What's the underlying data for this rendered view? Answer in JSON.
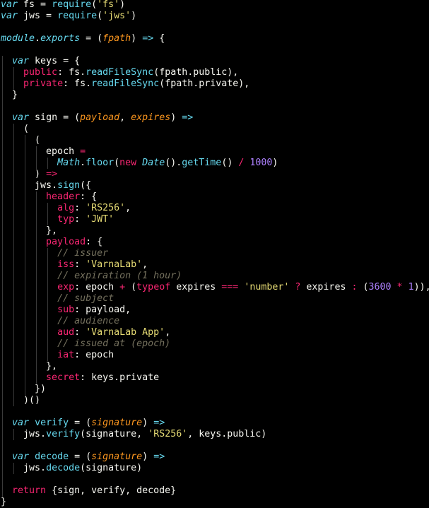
{
  "editor": {
    "theme": {
      "background": "#000000",
      "foreground": "#f8f8f2",
      "keyword": "#66d9ef",
      "property": "#f92672",
      "string": "#e6db74",
      "number": "#ae81ff",
      "parameter": "#fd971f",
      "comment": "#75715e"
    },
    "lines": [
      {
        "indent": 0,
        "tokens": [
          [
            "kw",
            "var"
          ],
          [
            "pl",
            " fs = "
          ],
          [
            "call",
            "require"
          ],
          [
            "pl",
            "("
          ],
          [
            "str",
            "'fs'"
          ],
          [
            "pl",
            ")"
          ]
        ]
      },
      {
        "indent": 0,
        "tokens": [
          [
            "kw",
            "var"
          ],
          [
            "pl",
            " jws = "
          ],
          [
            "call",
            "require"
          ],
          [
            "pl",
            "("
          ],
          [
            "str",
            "'jws'"
          ],
          [
            "pl",
            ")"
          ]
        ]
      },
      {
        "indent": 0,
        "tokens": []
      },
      {
        "indent": 0,
        "tokens": [
          [
            "it",
            "module"
          ],
          [
            "pl",
            "."
          ],
          [
            "it",
            "exports"
          ],
          [
            "pl",
            " = ("
          ],
          [
            "par",
            "fpath"
          ],
          [
            "pl",
            ") "
          ],
          [
            "call",
            "=>"
          ],
          [
            "pl",
            " {"
          ]
        ]
      },
      {
        "indent": 0,
        "tokens": []
      },
      {
        "indent": 2,
        "tokens": [
          [
            "kw",
            "var"
          ],
          [
            "pl",
            " keys = {"
          ]
        ]
      },
      {
        "indent": 4,
        "tokens": [
          [
            "key",
            "public"
          ],
          [
            "pl",
            ": fs."
          ],
          [
            "call",
            "readFileSync"
          ],
          [
            "pl",
            "(fpath.public),"
          ]
        ]
      },
      {
        "indent": 4,
        "tokens": [
          [
            "key",
            "private"
          ],
          [
            "pl",
            ": fs."
          ],
          [
            "call",
            "readFileSync"
          ],
          [
            "pl",
            "(fpath.private),"
          ]
        ]
      },
      {
        "indent": 2,
        "tokens": [
          [
            "pl",
            "}"
          ]
        ]
      },
      {
        "indent": 0,
        "tokens": []
      },
      {
        "indent": 2,
        "tokens": [
          [
            "kw",
            "var"
          ],
          [
            "pl",
            " sign = ("
          ],
          [
            "par",
            "payload"
          ],
          [
            "pl",
            ", "
          ],
          [
            "par",
            "expires"
          ],
          [
            "pl",
            ") "
          ],
          [
            "call",
            "=>"
          ]
        ]
      },
      {
        "indent": 4,
        "tokens": [
          [
            "pl",
            "("
          ]
        ]
      },
      {
        "indent": 6,
        "tokens": [
          [
            "pl",
            "("
          ]
        ]
      },
      {
        "indent": 8,
        "tokens": [
          [
            "pl",
            "epoch "
          ],
          [
            "op",
            "="
          ]
        ]
      },
      {
        "indent": 10,
        "tokens": [
          [
            "it",
            "Math"
          ],
          [
            "pl",
            "."
          ],
          [
            "call",
            "floor"
          ],
          [
            "pl",
            "("
          ],
          [
            "key",
            "new"
          ],
          [
            "pl",
            " "
          ],
          [
            "it",
            "Date"
          ],
          [
            "pl",
            "()."
          ],
          [
            "call",
            "getTime"
          ],
          [
            "pl",
            "() "
          ],
          [
            "op",
            "/"
          ],
          [
            "pl",
            " "
          ],
          [
            "num",
            "1000"
          ],
          [
            "pl",
            ")"
          ]
        ]
      },
      {
        "indent": 6,
        "tokens": [
          [
            "pl",
            ") "
          ],
          [
            "op",
            "=>"
          ]
        ]
      },
      {
        "indent": 6,
        "tokens": [
          [
            "pl",
            "jws."
          ],
          [
            "call",
            "sign"
          ],
          [
            "pl",
            "({"
          ]
        ]
      },
      {
        "indent": 8,
        "tokens": [
          [
            "key",
            "header"
          ],
          [
            "pl",
            ": {"
          ]
        ]
      },
      {
        "indent": 10,
        "tokens": [
          [
            "key",
            "alg"
          ],
          [
            "pl",
            ": "
          ],
          [
            "str",
            "'RS256'"
          ],
          [
            "pl",
            ","
          ]
        ]
      },
      {
        "indent": 10,
        "tokens": [
          [
            "key",
            "typ"
          ],
          [
            "pl",
            ": "
          ],
          [
            "str",
            "'JWT'"
          ]
        ]
      },
      {
        "indent": 8,
        "tokens": [
          [
            "pl",
            "},"
          ]
        ]
      },
      {
        "indent": 8,
        "tokens": [
          [
            "key",
            "payload"
          ],
          [
            "pl",
            ": {"
          ]
        ]
      },
      {
        "indent": 10,
        "tokens": [
          [
            "cm",
            "// issuer"
          ]
        ]
      },
      {
        "indent": 10,
        "tokens": [
          [
            "key",
            "iss"
          ],
          [
            "pl",
            ": "
          ],
          [
            "str",
            "'VarnaLab'"
          ],
          [
            "pl",
            ","
          ]
        ]
      },
      {
        "indent": 10,
        "tokens": [
          [
            "cm",
            "// expiration (1 hour)"
          ]
        ]
      },
      {
        "indent": 10,
        "tokens": [
          [
            "key",
            "exp"
          ],
          [
            "pl",
            ": epoch "
          ],
          [
            "op",
            "+"
          ],
          [
            "pl",
            " ("
          ],
          [
            "key",
            "typeof"
          ],
          [
            "pl",
            " expires "
          ],
          [
            "op",
            "==="
          ],
          [
            "pl",
            " "
          ],
          [
            "str",
            "'number'"
          ],
          [
            "pl",
            " "
          ],
          [
            "op",
            "?"
          ],
          [
            "pl",
            " expires "
          ],
          [
            "op",
            ":"
          ],
          [
            "pl",
            " ("
          ],
          [
            "num",
            "3600"
          ],
          [
            "pl",
            " "
          ],
          [
            "op",
            "*"
          ],
          [
            "pl",
            " "
          ],
          [
            "num",
            "1"
          ],
          [
            "pl",
            ")),"
          ]
        ]
      },
      {
        "indent": 10,
        "tokens": [
          [
            "cm",
            "// subject"
          ]
        ]
      },
      {
        "indent": 10,
        "tokens": [
          [
            "key",
            "sub"
          ],
          [
            "pl",
            ": payload,"
          ]
        ]
      },
      {
        "indent": 10,
        "tokens": [
          [
            "cm",
            "// audience"
          ]
        ]
      },
      {
        "indent": 10,
        "tokens": [
          [
            "key",
            "aud"
          ],
          [
            "pl",
            ": "
          ],
          [
            "str",
            "'VarnaLab App'"
          ],
          [
            "pl",
            ","
          ]
        ]
      },
      {
        "indent": 10,
        "tokens": [
          [
            "cm",
            "// issued at (epoch)"
          ]
        ]
      },
      {
        "indent": 10,
        "tokens": [
          [
            "key",
            "iat"
          ],
          [
            "pl",
            ": epoch"
          ]
        ]
      },
      {
        "indent": 8,
        "tokens": [
          [
            "pl",
            "},"
          ]
        ]
      },
      {
        "indent": 8,
        "tokens": [
          [
            "key",
            "secret"
          ],
          [
            "pl",
            ": keys.private"
          ]
        ]
      },
      {
        "indent": 6,
        "tokens": [
          [
            "pl",
            "})"
          ]
        ]
      },
      {
        "indent": 4,
        "tokens": [
          [
            "pl",
            ")()"
          ]
        ]
      },
      {
        "indent": 0,
        "tokens": []
      },
      {
        "indent": 2,
        "tokens": [
          [
            "kw",
            "var"
          ],
          [
            "pl",
            " "
          ],
          [
            "call",
            "verify"
          ],
          [
            "pl",
            " = ("
          ],
          [
            "par",
            "signature"
          ],
          [
            "pl",
            ") "
          ],
          [
            "call",
            "=>"
          ]
        ]
      },
      {
        "indent": 4,
        "tokens": [
          [
            "pl",
            "jws."
          ],
          [
            "call",
            "verify"
          ],
          [
            "pl",
            "(signature, "
          ],
          [
            "str",
            "'RS256'"
          ],
          [
            "pl",
            ", keys.public)"
          ]
        ]
      },
      {
        "indent": 0,
        "tokens": []
      },
      {
        "indent": 2,
        "tokens": [
          [
            "kw",
            "var"
          ],
          [
            "pl",
            " "
          ],
          [
            "call",
            "decode"
          ],
          [
            "pl",
            " = ("
          ],
          [
            "par",
            "signature"
          ],
          [
            "pl",
            ") "
          ],
          [
            "call",
            "=>"
          ]
        ]
      },
      {
        "indent": 4,
        "tokens": [
          [
            "pl",
            "jws."
          ],
          [
            "call",
            "decode"
          ],
          [
            "pl",
            "(signature)"
          ]
        ]
      },
      {
        "indent": 0,
        "tokens": []
      },
      {
        "indent": 2,
        "tokens": [
          [
            "key",
            "return"
          ],
          [
            "pl",
            " {sign, verify, decode}"
          ]
        ]
      },
      {
        "indent": 0,
        "tokens": [
          [
            "pl",
            "}"
          ]
        ]
      }
    ]
  }
}
